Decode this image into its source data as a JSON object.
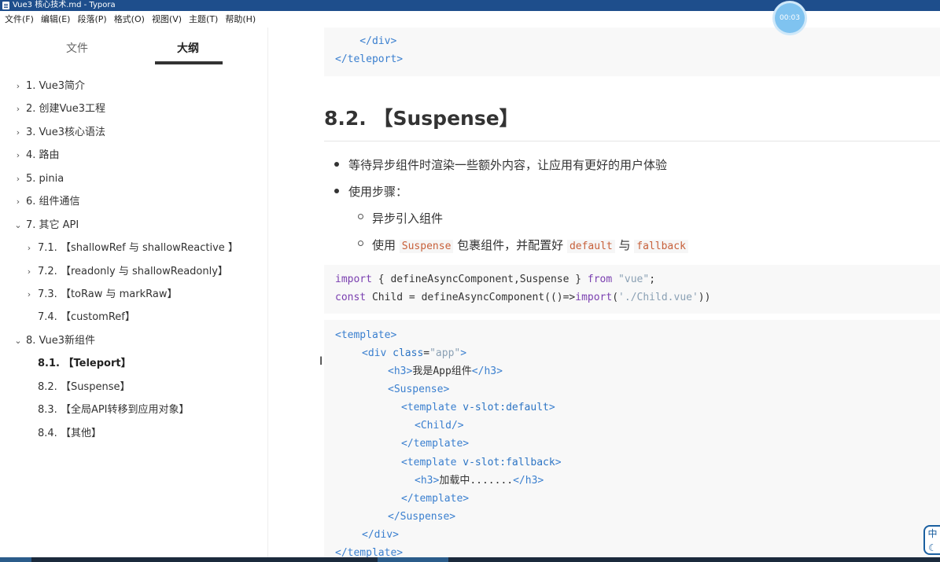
{
  "window": {
    "title": "Vue3 核心技术.md - Typora"
  },
  "menu": [
    "文件(F)",
    "编辑(E)",
    "段落(P)",
    "格式(O)",
    "视图(V)",
    "主题(T)",
    "帮助(H)"
  ],
  "sidebar": {
    "tabs": {
      "files": "文件",
      "outline": "大纲"
    },
    "items": [
      {
        "label": "1. Vue3简介",
        "level": 1,
        "caret": "›"
      },
      {
        "label": "2. 创建Vue3工程",
        "level": 1,
        "caret": "›"
      },
      {
        "label": "3. Vue3核心语法",
        "level": 1,
        "caret": "›"
      },
      {
        "label": "4. 路由",
        "level": 1,
        "caret": "›"
      },
      {
        "label": "5. pinia",
        "level": 1,
        "caret": "›"
      },
      {
        "label": "6. 组件通信",
        "level": 1,
        "caret": "›"
      },
      {
        "label": "7. 其它 API",
        "level": 1,
        "caret": "⌄"
      },
      {
        "label": "7.1. 【shallowRef 与 shallowReactive 】",
        "level": 2,
        "caret": "›"
      },
      {
        "label": "7.2. 【readonly 与 shallowReadonly】",
        "level": 2,
        "caret": "›"
      },
      {
        "label": "7.3. 【toRaw 与 markRaw】",
        "level": 2,
        "caret": "›"
      },
      {
        "label": "7.4. 【customRef】",
        "level": 2,
        "caret": ""
      },
      {
        "label": "8. Vue3新组件",
        "level": 1,
        "caret": "⌄"
      },
      {
        "label": "8.1. 【Teleport】",
        "level": 2,
        "caret": "",
        "active": true
      },
      {
        "label": "8.2. 【Suspense】",
        "level": 2,
        "caret": ""
      },
      {
        "label": "8.3. 【全局API转移到应用对象】",
        "level": 2,
        "caret": ""
      },
      {
        "label": "8.4. 【其他】",
        "level": 2,
        "caret": ""
      }
    ]
  },
  "content": {
    "code1": {
      "l1": "    </div>",
      "l2": "</teleport>"
    },
    "heading": "8.2. 【Suspense】",
    "bullets": {
      "b1": "等待异步组件时渲染一些额外内容，让应用有更好的用户体验",
      "b2": "使用步骤：",
      "sub1": "异步引入组件",
      "sub2_pre": "使用 ",
      "sub2_code1": "Suspense",
      "sub2_mid": " 包裹组件，并配置好 ",
      "sub2_code2": "default",
      "sub2_and": " 与 ",
      "sub2_code3": "fallback"
    },
    "code2": {
      "l1_kw1": "import",
      "l1_mid": " { defineAsyncComponent,Suspense } ",
      "l1_kw2": "from",
      "l1_str": " \"vue\"",
      "l1_end": ";",
      "l2_kw": "const",
      "l2_mid": " Child = defineAsyncComponent(()=>",
      "l2_kw2": "import",
      "l2_p1": "(",
      "l2_str": "'./Child.vue'",
      "l2_p2": "))"
    },
    "code3": {
      "l1": "<template>",
      "l2_tag": "<div",
      "l2_attr": " class",
      "l2_eq": "=",
      "l2_str": "\"app\"",
      "l2_end": ">",
      "l3_t1": "<h3>",
      "l3_txt": "我是App组件",
      "l3_t2": "</h3>",
      "l4": "<Suspense>",
      "l5_tag": "<template",
      "l5_attr": " v-slot:default",
      "l5_end": ">",
      "l6": "<Child/>",
      "l7": "</template>",
      "l8_tag": "<template",
      "l8_attr": " v-slot:fallback",
      "l8_end": ">",
      "l9_t1": "<h3>",
      "l9_txt": "加载中.......",
      "l9_t2": "</h3>",
      "l10": "</template>",
      "l11": "</Suspense>",
      "l12": "</div>",
      "l13": "</template>"
    }
  },
  "overlay": {
    "timer": "00:03",
    "ime": "中"
  }
}
